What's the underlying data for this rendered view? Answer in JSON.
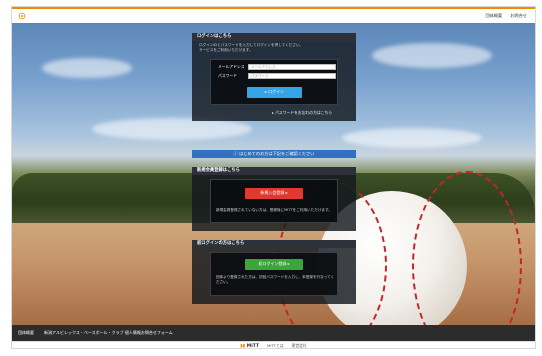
{
  "header": {
    "links": [
      "団体概要",
      "お問合せ"
    ]
  },
  "login": {
    "title": "ログインはこちら",
    "desc": "ログインIDとパスワードを入力してログインを押してください。\nサービスをご利用いただけます。",
    "email_label": "メールアドレス",
    "email_placeholder": "メールアドレス",
    "password_label": "パスワード",
    "password_placeholder": "パスワード",
    "button_label": "ログイン",
    "forgot_link": "パスワードをお忘れの方はこちら"
  },
  "notice": {
    "text": "はじめてのお方は下記をご確認ください"
  },
  "new_member": {
    "title": "新規会員登録はこちら",
    "button_label": "新規入会登録",
    "desc": "新規会員登録されていない方は、登録後にMITTをご利用いただけます。"
  },
  "first_login": {
    "title": "初ログインの方はこちら",
    "button_label": "初ログイン登録",
    "desc": "団体より登録された方は、初回パスワードを入力し、本登録を行なってください。"
  },
  "footer": {
    "links": [
      "団体概要",
      "新潟アルビレックス・ベースボール・クラブ 個人情報お問合せフォーム"
    ]
  },
  "footer_bottom": {
    "brand": "MiTT",
    "links": [
      "MiTTとは",
      "運営会社"
    ]
  },
  "colors": {
    "accent_orange": "#f08a00",
    "login_button": "#36a4e4",
    "register_button": "#e2392f",
    "first_login_button": "#3aa63a",
    "notice_bar": "#2f72c2"
  }
}
